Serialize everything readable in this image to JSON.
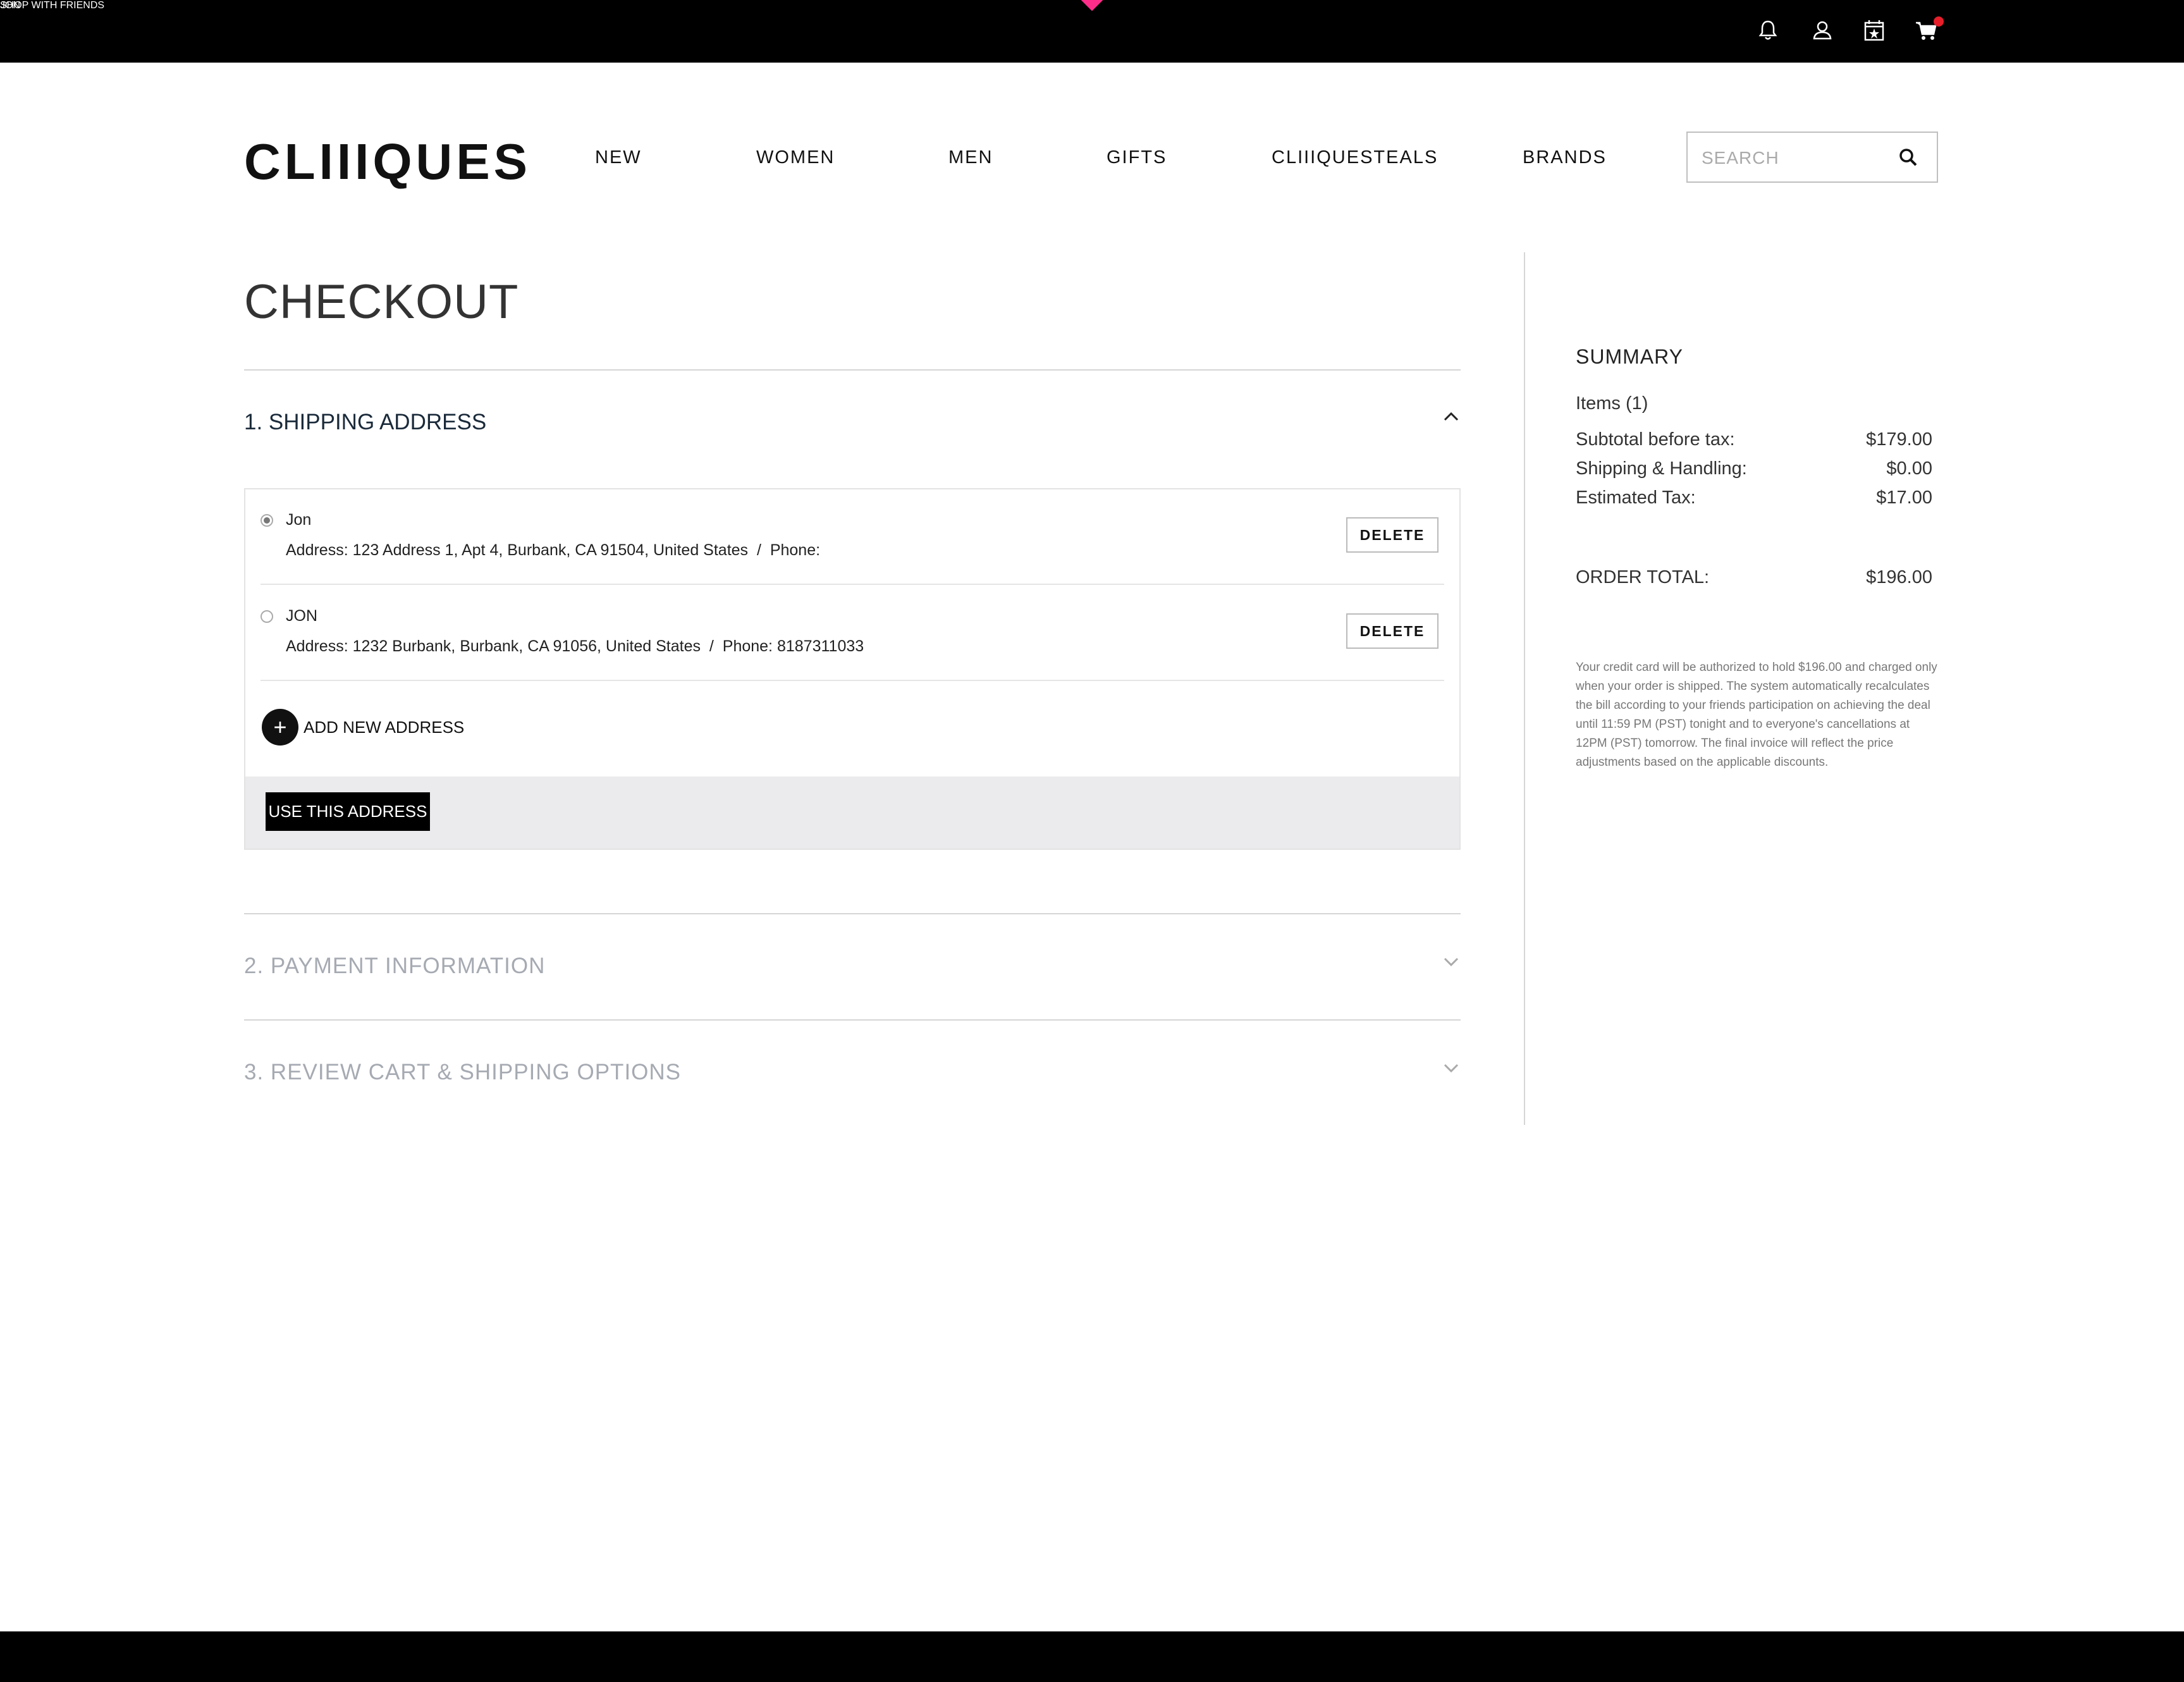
{
  "topbar": {
    "user": "JON",
    "center_label": "SHOP WITH FRIENDS",
    "icons": [
      "bell-icon",
      "user-icon",
      "calendar-star-icon",
      "cart-icon"
    ],
    "accent": "#ff2d8a",
    "badge_color": "#e51e2a"
  },
  "header": {
    "logo": "CLIIIQUES",
    "nav": [
      "NEW",
      "WOMEN",
      "MEN",
      "GIFTS",
      "CLIIIQUESTEALS",
      "BRANDS"
    ],
    "search_placeholder": "SEARCH"
  },
  "checkout": {
    "title": "CHECKOUT",
    "section1": "1. SHIPPING ADDRESS",
    "addresses": [
      {
        "name": "Jon",
        "address_label": "Address:",
        "address": "123 Address 1, Apt 4, Burbank, CA 91504, United States",
        "sep": "/",
        "phone_label": "Phone:",
        "phone": "",
        "selected": true,
        "delete": "DELETE"
      },
      {
        "name": "JON",
        "address_label": "Address:",
        "address": "1232 Burbank, Burbank, CA 91056, United States",
        "sep": "/",
        "phone_label": "Phone:",
        "phone": "8187311033",
        "selected": false,
        "delete": "DELETE"
      }
    ],
    "add_new": "ADD NEW ADDRESS",
    "use_button": "USE THIS ADDRESS",
    "section2": "2. PAYMENT INFORMATION",
    "section3": "3. REVIEW CART & SHIPPING OPTIONS"
  },
  "summary": {
    "title": "SUMMARY",
    "items": "Items (1)",
    "subtotal_label": "Subtotal before tax:",
    "subtotal": "$179.00",
    "shipping_label": "Shipping & Handling:",
    "shipping": "$0.00",
    "tax_label": "Estimated Tax:",
    "tax": "$17.00",
    "total_label": "ORDER TOTAL:",
    "total": "$196.00",
    "note": "Your credit card will be authorized to hold $196.00 and charged only when your order is shipped. The system automatically recalculates the bill according to your friends participation on achieving the deal until 11:59 PM (PST) tonight and to everyone's cancellations at 12PM (PST) tomorrow. The final invoice will reflect the price adjustments based on the applicable discounts."
  }
}
